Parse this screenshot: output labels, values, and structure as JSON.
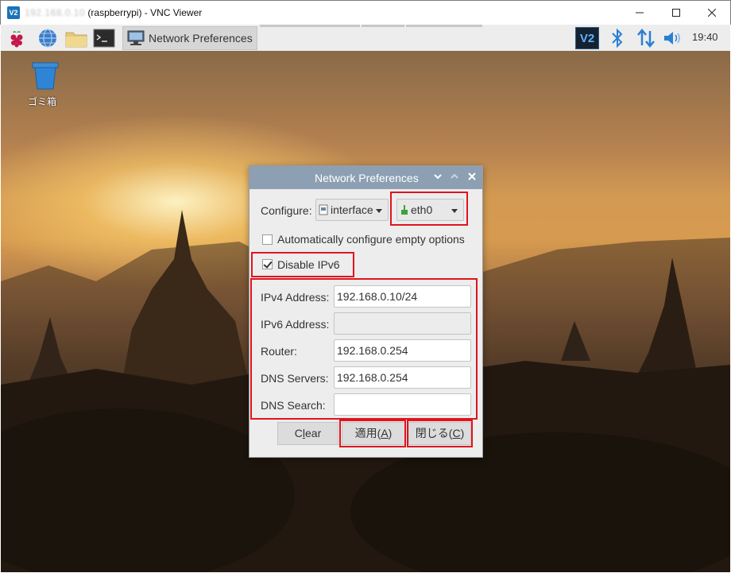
{
  "window": {
    "title_ip": "192.168.0.10",
    "title_rest": "(raspberrypi) - VNC Viewer",
    "logo": "V2",
    "controls": [
      "minimize-icon",
      "maximize-icon",
      "close-icon"
    ]
  },
  "taskbar": {
    "launchers": [
      "raspberry-menu-icon",
      "web-browser-icon",
      "file-manager-icon",
      "terminal-icon"
    ],
    "active_task": "Network Preferences",
    "tray": {
      "vnc_logo": "V2",
      "icons": [
        "bluetooth-icon",
        "network-icon",
        "volume-icon"
      ],
      "clock": "19:40"
    }
  },
  "desktop": {
    "trash_label": "ゴミ箱"
  },
  "dialog": {
    "title": "Network Preferences",
    "title_buttons": [
      "minimize-icon",
      "maximize-icon",
      "close-icon"
    ],
    "configure_label": "Configure:",
    "configure_type": "interface",
    "configure_target": "eth0",
    "auto_configure_label": "Automatically configure empty options",
    "auto_configure_checked": false,
    "disable_ipv6_label": "Disable IPv6",
    "disable_ipv6_checked": true,
    "fields": {
      "ipv4_label": "IPv4 Address:",
      "ipv4_value": "192.168.0.10/24",
      "ipv6_label": "IPv6 Address:",
      "ipv6_value": "",
      "router_label": "Router:",
      "router_value": "192.168.0.254",
      "dns_servers_label": "DNS Servers:",
      "dns_servers_value": "192.168.0.254",
      "dns_search_label": "DNS Search:",
      "dns_search_value": ""
    },
    "buttons": {
      "clear_pre": "C",
      "clear_mnemonic": "l",
      "clear_post": "ear",
      "apply_pre": "適用(",
      "apply_mnemonic": "A",
      "apply_post": ")",
      "close_pre": "閉じる(",
      "close_mnemonic": "C",
      "close_post": ")"
    }
  },
  "colors": {
    "highlight": "#e0141e",
    "dialog_title_bar": "#8da0b3",
    "vnc_accent": "#1a73b8"
  }
}
